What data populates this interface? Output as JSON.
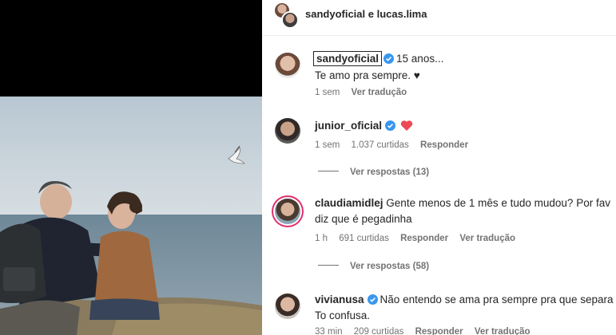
{
  "header": {
    "title": "sandyoficial e lucas.lima"
  },
  "comments": [
    {
      "username": "sandyoficial",
      "verified": true,
      "line1": "15 anos...",
      "line2": "Te amo pra sempre. ♥",
      "time": "1 sem",
      "translate": "Ver tradução"
    },
    {
      "username": "junior_oficial",
      "verified": true,
      "emoji": "heart",
      "time": "1 sem",
      "likes": "1.037 curtidas",
      "reply": "Responder",
      "view_replies": "Ver respostas (13)"
    },
    {
      "username": "claudiamidlej",
      "verified": false,
      "line1": "Gente menos de 1 mês e tudo mudou? Por fav",
      "line2": "diz que é pegadinha",
      "time": "1 h",
      "likes": "691 curtidas",
      "reply": "Responder",
      "translate": "Ver tradução",
      "view_replies": "Ver respostas (58)"
    },
    {
      "username": "vivianusa",
      "verified": true,
      "line1": "Não entendo se ama pra sempre pra que separa",
      "line2": "To confusa.",
      "time": "33 min",
      "likes": "209 curtidas",
      "reply": "Responder",
      "translate": "Ver tradução"
    }
  ],
  "colors": {
    "verified_blue": "#3897f0",
    "heart_red": "#ed4956",
    "story_ring": "#e1306c",
    "meta_gray": "#737373"
  },
  "icons": [
    "verified-badge-icon",
    "heart-icon"
  ]
}
